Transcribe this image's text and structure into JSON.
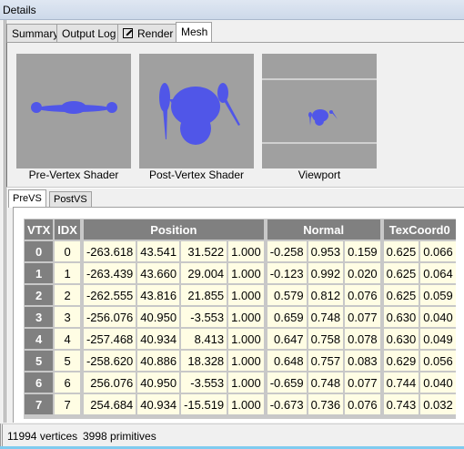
{
  "window": {
    "title": "Details"
  },
  "tabs": [
    {
      "label": "Summary"
    },
    {
      "label": "Output Log"
    },
    {
      "label": "Render",
      "icon": "edit-icon"
    },
    {
      "label": "Mesh",
      "active": true
    }
  ],
  "mesh_views": [
    {
      "label": "Pre-Vertex Shader"
    },
    {
      "label": "Post-Vertex Shader"
    },
    {
      "label": "Viewport"
    }
  ],
  "mesh_color": "#5056e8",
  "subtabs": [
    {
      "label": "PreVS",
      "active": true
    },
    {
      "label": "PostVS"
    }
  ],
  "table": {
    "headers": {
      "vtx": "VTX",
      "idx": "IDX",
      "position": "Position",
      "normal": "Normal",
      "texcoord": "TexCoord0"
    },
    "rows": [
      {
        "vtx": "0",
        "idx": "0",
        "pos": [
          "-263.618",
          "43.541",
          "31.522",
          "1.000"
        ],
        "normal": [
          "-0.258",
          "0.953",
          "0.159"
        ],
        "tex": [
          "0.625",
          "0.066"
        ]
      },
      {
        "vtx": "1",
        "idx": "1",
        "pos": [
          "-263.439",
          "43.660",
          "29.004",
          "1.000"
        ],
        "normal": [
          "-0.123",
          "0.992",
          "0.020"
        ],
        "tex": [
          "0.625",
          "0.064"
        ]
      },
      {
        "vtx": "2",
        "idx": "2",
        "pos": [
          "-262.555",
          "43.816",
          "21.855",
          "1.000"
        ],
        "normal": [
          "0.579",
          "0.812",
          "0.076"
        ],
        "tex": [
          "0.625",
          "0.059"
        ]
      },
      {
        "vtx": "3",
        "idx": "3",
        "pos": [
          "-256.076",
          "40.950",
          "-3.553",
          "1.000"
        ],
        "normal": [
          "0.659",
          "0.748",
          "0.077"
        ],
        "tex": [
          "0.630",
          "0.040"
        ]
      },
      {
        "vtx": "4",
        "idx": "4",
        "pos": [
          "-257.468",
          "40.934",
          "8.413",
          "1.000"
        ],
        "normal": [
          "0.647",
          "0.758",
          "0.078"
        ],
        "tex": [
          "0.630",
          "0.049"
        ]
      },
      {
        "vtx": "5",
        "idx": "5",
        "pos": [
          "-258.620",
          "40.886",
          "18.328",
          "1.000"
        ],
        "normal": [
          "0.648",
          "0.757",
          "0.083"
        ],
        "tex": [
          "0.629",
          "0.056"
        ]
      },
      {
        "vtx": "6",
        "idx": "6",
        "pos": [
          "256.076",
          "40.950",
          "-3.553",
          "1.000"
        ],
        "normal": [
          "-0.659",
          "0.748",
          "0.077"
        ],
        "tex": [
          "0.744",
          "0.040"
        ]
      },
      {
        "vtx": "7",
        "idx": "7",
        "pos": [
          "254.684",
          "40.934",
          "-15.519",
          "1.000"
        ],
        "normal": [
          "-0.673",
          "0.736",
          "0.076"
        ],
        "tex": [
          "0.743",
          "0.032"
        ]
      }
    ]
  },
  "status": {
    "vertices": "11994 vertices",
    "primitives": "3998 primitives"
  }
}
